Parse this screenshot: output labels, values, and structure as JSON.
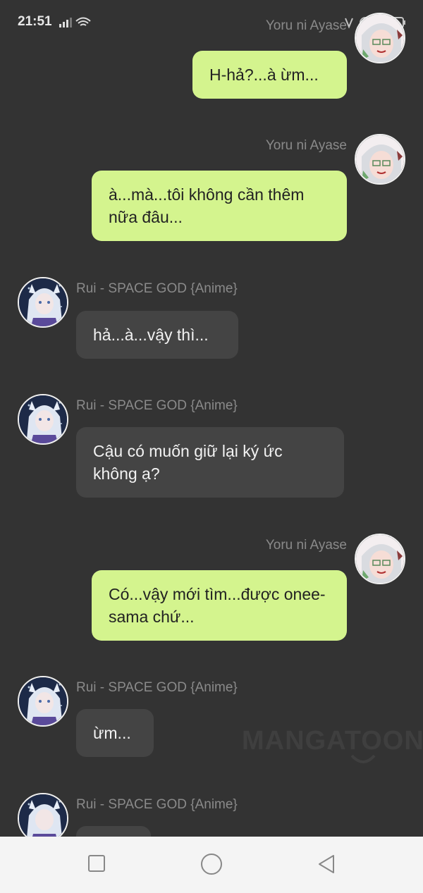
{
  "status_bar": {
    "time": "21:51"
  },
  "watermark": "MANGATOON",
  "messages": [
    {
      "side": "right",
      "sender": "Yoru ni Ayase",
      "text": "H-hả?...à ừm..."
    },
    {
      "side": "right",
      "sender": "Yoru ni Ayase",
      "text": "à...mà...tôi không cần thêm nữa đâu..."
    },
    {
      "side": "left",
      "sender": "Rui - SPACE GOD {Anime}",
      "text": "hả...à...vậy thì..."
    },
    {
      "side": "left",
      "sender": "Rui - SPACE GOD {Anime}",
      "text": "Cậu có muốn giữ lại ký ức không ạ?"
    },
    {
      "side": "right",
      "sender": "Yoru ni Ayase",
      "text": "Có...vậy mới tìm...được onee-sama chứ..."
    },
    {
      "side": "left",
      "sender": "Rui - SPACE GOD {Anime}",
      "text": "ừm..."
    },
    {
      "side": "left",
      "sender": "Rui - SPACE GOD {Anime}",
      "text": ""
    }
  ],
  "colors": {
    "background": "#333333",
    "right_bubble": "#d4f48e",
    "left_bubble": "#444444",
    "sender_name": "#8a8a8a",
    "nav_bar": "#f4f4f4"
  },
  "nav": {
    "icons": [
      "square-recents-icon",
      "circle-home-icon",
      "triangle-back-icon"
    ]
  }
}
